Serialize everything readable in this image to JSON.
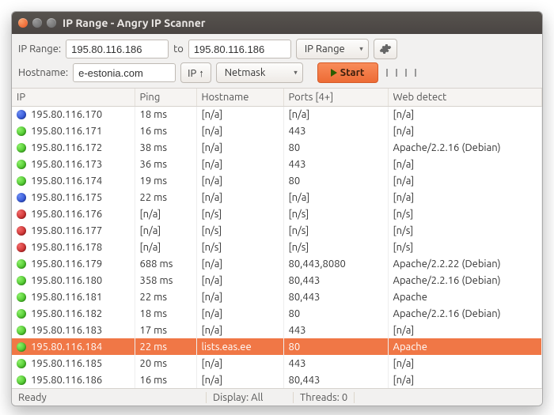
{
  "window": {
    "title": "IP Range - Angry IP Scanner"
  },
  "toolbar": {
    "range_label": "IP Range:",
    "range_start": "195.80.116.186",
    "range_to_label": "to",
    "range_end": "195.80.116.186",
    "mode_label": "IP Range",
    "hostname_label": "Hostname:",
    "hostname_value": "e-estonia.com",
    "ip_up_label": "IP ↑",
    "netmask_label": "Netmask",
    "start_label": "Start"
  },
  "columns": {
    "ip": "IP",
    "ping": "Ping",
    "hostname": "Hostname",
    "ports": "Ports [4+]",
    "web": "Web detect"
  },
  "rows": [
    {
      "status": "b",
      "ip": "195.80.116.170",
      "ping": "18 ms",
      "host": "[n/a]",
      "ports": "[n/a]",
      "web": "[n/a]"
    },
    {
      "status": "g",
      "ip": "195.80.116.171",
      "ping": "16 ms",
      "host": "[n/a]",
      "ports": "443",
      "web": "[n/a]"
    },
    {
      "status": "g",
      "ip": "195.80.116.172",
      "ping": "38 ms",
      "host": "[n/a]",
      "ports": "80",
      "web": "Apache/2.2.16 (Debian)"
    },
    {
      "status": "g",
      "ip": "195.80.116.173",
      "ping": "36 ms",
      "host": "[n/a]",
      "ports": "443",
      "web": "[n/a]"
    },
    {
      "status": "g",
      "ip": "195.80.116.174",
      "ping": "19 ms",
      "host": "[n/a]",
      "ports": "80",
      "web": "[n/a]"
    },
    {
      "status": "b",
      "ip": "195.80.116.175",
      "ping": "22 ms",
      "host": "[n/a]",
      "ports": "[n/a]",
      "web": "[n/a]"
    },
    {
      "status": "r",
      "ip": "195.80.116.176",
      "ping": "[n/a]",
      "host": "[n/s]",
      "ports": "[n/s]",
      "web": "[n/s]"
    },
    {
      "status": "r",
      "ip": "195.80.116.177",
      "ping": "[n/a]",
      "host": "[n/s]",
      "ports": "[n/s]",
      "web": "[n/s]"
    },
    {
      "status": "r",
      "ip": "195.80.116.178",
      "ping": "[n/a]",
      "host": "[n/s]",
      "ports": "[n/s]",
      "web": "[n/s]"
    },
    {
      "status": "g",
      "ip": "195.80.116.179",
      "ping": "688 ms",
      "host": "[n/a]",
      "ports": "80,443,8080",
      "web": "Apache/2.2.22 (Debian)"
    },
    {
      "status": "g",
      "ip": "195.80.116.180",
      "ping": "358 ms",
      "host": "[n/a]",
      "ports": "80,443",
      "web": "Apache/2.2.16 (Debian)"
    },
    {
      "status": "g",
      "ip": "195.80.116.181",
      "ping": "22 ms",
      "host": "[n/a]",
      "ports": "80,443",
      "web": "Apache"
    },
    {
      "status": "g",
      "ip": "195.80.116.182",
      "ping": "18 ms",
      "host": "[n/a]",
      "ports": "80",
      "web": "Apache/2.2.16 (Debian)"
    },
    {
      "status": "g",
      "ip": "195.80.116.183",
      "ping": "17 ms",
      "host": "[n/a]",
      "ports": "443",
      "web": "[n/a]"
    },
    {
      "status": "g",
      "ip": "195.80.116.184",
      "ping": "22 ms",
      "host": "lists.eas.ee",
      "ports": "80",
      "web": "Apache",
      "selected": true
    },
    {
      "status": "g",
      "ip": "195.80.116.185",
      "ping": "20 ms",
      "host": "[n/a]",
      "ports": "443",
      "web": "[n/a]"
    },
    {
      "status": "g",
      "ip": "195.80.116.186",
      "ping": "16 ms",
      "host": "[n/a]",
      "ports": "80,443",
      "web": "[n/a]"
    }
  ],
  "status": {
    "ready": "Ready",
    "display": "Display: All",
    "threads": "Threads: 0"
  }
}
